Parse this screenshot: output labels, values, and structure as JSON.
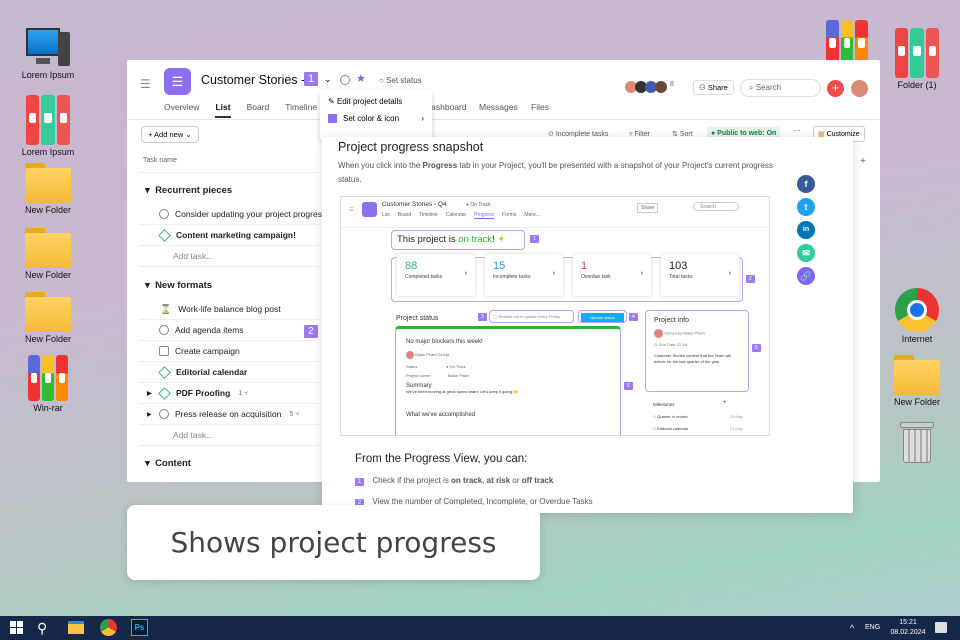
{
  "desktop": {
    "left_icons": [
      "Lorem Ipsum",
      "Lorem Ipsum",
      "New Folder",
      "New Folder",
      "New Folder",
      "Win-rar"
    ],
    "right_icons": [
      "Folder (1)",
      "Internet",
      "New Folder"
    ]
  },
  "app": {
    "title": "Customer Stories - ",
    "status": "Set status",
    "member_count": "8",
    "share": "Share",
    "search_placeholder": "Search",
    "tabs": [
      "Overview",
      "List",
      "Board",
      "Timeline",
      "Dashboard",
      "Messages",
      "Files"
    ],
    "dropdown": [
      "Edit project details",
      "Set color & icon"
    ],
    "toolbar": {
      "add_new": "+ Add new",
      "incomplete": "Incomplete tasks",
      "filter": "Filter",
      "sort": "Sort",
      "public": "Public to web: On",
      "customize": "Customize"
    },
    "column": "Task name",
    "sections": [
      {
        "name": "Recurrent pieces",
        "tasks": [
          "Consider updating your project progres",
          "Content marketing campaign!"
        ]
      },
      {
        "name": "New formats",
        "tasks": [
          "Work-life balance blog post",
          "Add agenda items",
          "Create campaign",
          "Editorial calendar",
          "PDF Proofing",
          "Press release on acquisition"
        ]
      },
      {
        "name": "Content"
      }
    ],
    "add_task": "Add task...",
    "subtask_counts": [
      "1",
      "5"
    ],
    "badges": [
      "1",
      "2"
    ]
  },
  "overlay": {
    "title": "Project progress snapshot",
    "intro_pre": "When you click into the ",
    "intro_bold": "Progress",
    "intro_post": " tab in your Project, you'll be presented with a snapshot of your Project's current progress status.",
    "shot": {
      "project": "Customer Stories - Q4",
      "status": "On Track",
      "tabs": [
        "List",
        "Board",
        "Timeline",
        "Calendar",
        "Progress",
        "Forms",
        "More..."
      ],
      "search": "Search",
      "share": "Share",
      "headline_pre": "This project is ",
      "headline_green": "on track",
      "headline_post": "!",
      "stats": [
        {
          "n": "88",
          "t": "Completed tasks",
          "c": "#2bb58a"
        },
        {
          "n": "15",
          "t": "Incomplete tasks",
          "c": "#2a9ee8"
        },
        {
          "n": "1",
          "t": "Overdue task",
          "c": "#e8474c"
        },
        {
          "n": "103",
          "t": "Total tasks",
          "c": "#222"
        }
      ],
      "project_status": "Project status",
      "remind": "Remind me to update every Friday",
      "update": "Update status",
      "card_title": "No major blockers this week!",
      "author": "Blake Pham",
      "date": "24 Apr",
      "status_label": "Status",
      "status_value": "On Track",
      "owner_label": "Project owner",
      "owner_value": "Blake Pham",
      "summary": "Summary",
      "summary_text": "We've been moving at great speed team! Let's keep it going 🙌",
      "accomplished": "What we've accomplished",
      "info_title": "Project info",
      "owned_by": "Owned by",
      "owner": "Blake Pham",
      "due_label": "Due Date",
      "due": "22 Jul",
      "info_text": "Customer Stories content that the Team will deliver for the last quarter of the year",
      "milestones": "Milestones",
      "ms": [
        {
          "n": "Quarter in review",
          "d": "20 May"
        },
        {
          "n": "Editorial calendar",
          "d": "21 May"
        }
      ],
      "labels": [
        "1",
        "2",
        "3",
        "4",
        "5",
        "6"
      ]
    },
    "from_title": "From the Progress View, you can:",
    "points": [
      {
        "n": "1",
        "pre": "Check if the project is ",
        "b1": "on track",
        "m1": ", ",
        "b2": "at risk",
        "m2": " or ",
        "b3": "off track"
      },
      {
        "n": "2",
        "pre": "View the number of Completed, Incomplete, or Overdue Tasks"
      }
    ],
    "social": [
      "f",
      "t",
      "in",
      "✉",
      "🔗"
    ]
  },
  "caption": "Shows project progress",
  "taskbar": {
    "lang": "ENG",
    "time": "15:21",
    "date": "08.02.2024",
    "ps": "Ps"
  }
}
